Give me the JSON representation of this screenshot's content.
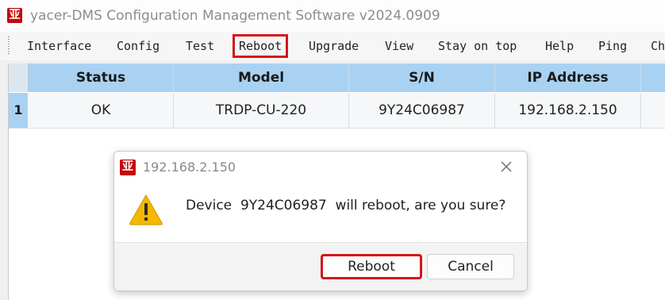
{
  "app": {
    "icon_glyph": "亚",
    "title": "yacer-DMS Configuration Management Software v2024.0909"
  },
  "menu": [
    {
      "label": "Interface"
    },
    {
      "label": "Config"
    },
    {
      "label": "Test"
    },
    {
      "label": "Reboot",
      "highlighted": true
    },
    {
      "label": "Upgrade"
    },
    {
      "label": "View"
    },
    {
      "label": "Stay on top"
    },
    {
      "label": "Help"
    },
    {
      "label": "Ping"
    },
    {
      "label": "Ch"
    }
  ],
  "grid": {
    "columns": [
      "Status",
      "Model",
      "S/N",
      "IP Address"
    ],
    "rows": [
      {
        "index": "1",
        "status": "OK",
        "model": "TRDP-CU-220",
        "sn": "9Y24C06987",
        "ip": "192.168.2.150"
      }
    ],
    "header_color": "#a9d2f2"
  },
  "dialog": {
    "title": "192.168.2.150",
    "message": "Device  9Y24C06987  will reboot, are you sure?",
    "icon": "warning-icon",
    "buttons": {
      "confirm": "Reboot",
      "cancel": "Cancel"
    }
  },
  "colors": {
    "highlight_border": "#d6151b",
    "warning": "#f5b800"
  }
}
